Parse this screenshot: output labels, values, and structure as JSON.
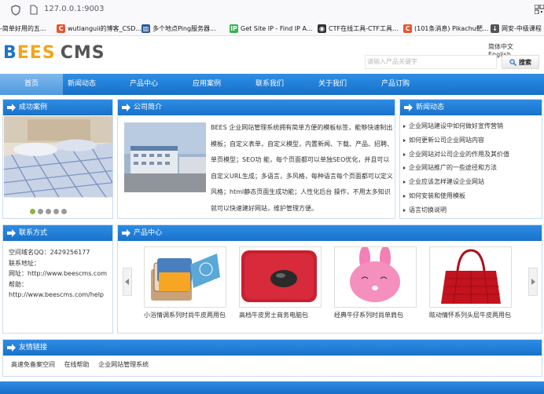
{
  "browser": {
    "url": "127.0.0.1:9003",
    "bookmarks": [
      {
        "label": "-简单好用的五...",
        "icon": "",
        "color": ""
      },
      {
        "label": "wutianguii的博客_CSD...",
        "icon": "C",
        "color": "#e8552f"
      },
      {
        "label": "多个地点Ping服务器...",
        "icon": "▥",
        "color": "#2c5aa0"
      },
      {
        "label": "Get Site IP - Find IP A...",
        "icon": "IP",
        "color": "#35b34a"
      },
      {
        "label": "CTF在线工具-CTF工具...",
        "icon": "◉",
        "color": "#333333"
      },
      {
        "label": "(101条消息) Pikachu靶...",
        "icon": "C",
        "color": "#e8552f"
      },
      {
        "label": "网安-中级课程",
        "icon": "↓",
        "color": "#555555"
      }
    ]
  },
  "header": {
    "logo": {
      "b": "B",
      "ees": "EES",
      "cms": "CMS"
    },
    "lang_cn": "简体中文",
    "lang_en": "English",
    "search_placeholder": "请输入产品关键字",
    "search_button": "搜索"
  },
  "nav": [
    "首页",
    "新闻动态",
    "产品中心",
    "应用案例",
    "联系我们",
    "关于我们",
    "产品订购"
  ],
  "cases": {
    "title": "成功案例",
    "dots": 5,
    "active_dot": 0
  },
  "intro": {
    "title": "公司简介",
    "text": "BEES 企业网站管理系统拥有简单方便的模板标签，能够快速制出模板；自定义表单，自定义模型，内置新闻、下载、产品、招聘、单页模型；SEO功 能，每个页面都可以单独SEO优化，并且可以自定义URL生成；多语言，多风格，每种语言每个页面都可以定义风格；html静态页面生成功能；人性化后台 操作，不用太多知识就可以快速建好网站，维护管理方便。"
  },
  "news": {
    "title": "新闻动态",
    "items": [
      "企业网站建设中如何做好宣传营销",
      "如何更新公司企业网站内容",
      "企业网站对公司企业的作用及其价值",
      "企业网站推广的一些途径和方法",
      "企业应该怎样建设企业网站",
      "如何安装和使用模板",
      "语言切换说明"
    ]
  },
  "contact": {
    "title": "联系方式",
    "lines": [
      "空间域名QQ：2429256177",
      "联系地址：",
      "网址：http://www.beescms.com",
      "帮助：http://www.beescms.com/help"
    ]
  },
  "products": {
    "title": "产品中心",
    "items": [
      "小浴情调系列时尚牛皮两用包",
      "高档牛皮男士商务电脑包",
      "经典牛仔系列时尚单肩包",
      "眩动情怀系列头层牛皮两用包"
    ]
  },
  "links": {
    "title": "友情链接",
    "items": [
      "高速免备案空间",
      "在线帮助",
      "企业网站管理系统"
    ]
  }
}
